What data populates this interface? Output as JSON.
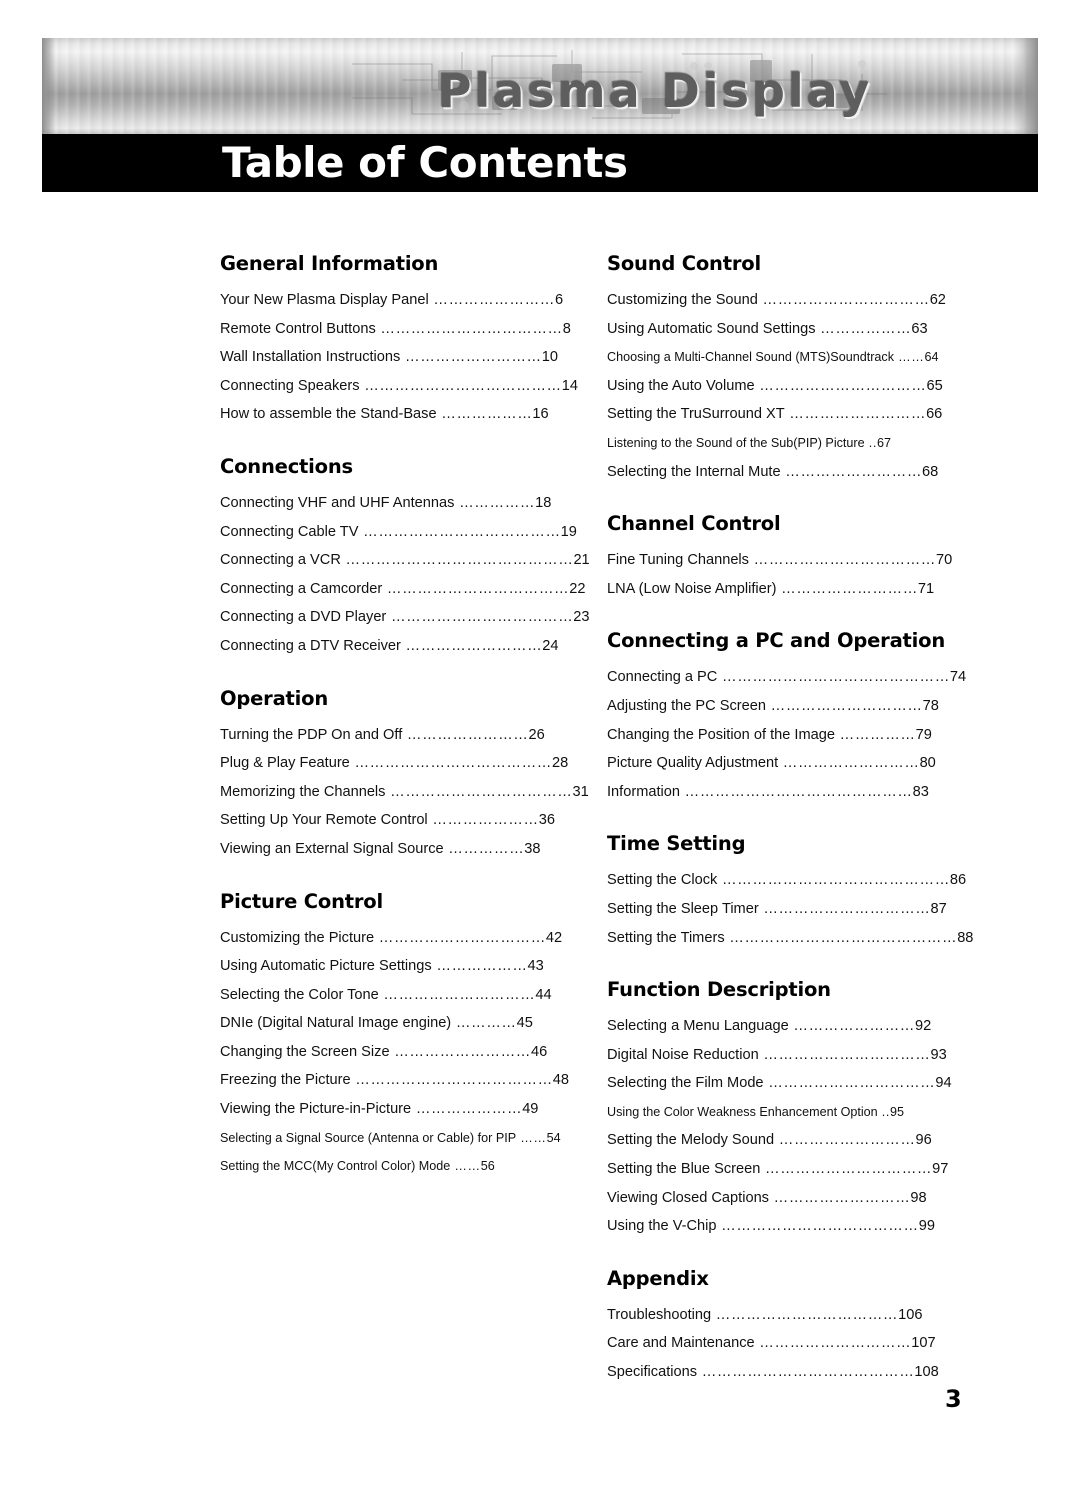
{
  "banner": {
    "brand_title": "Plasma Display",
    "page_title": "Table of Contents"
  },
  "page_number": "3",
  "left_column": [
    {
      "heading": "General Information",
      "entries": [
        {
          "label": "Your New Plasma Display Panel",
          "dots": "……………………",
          "page": "6"
        },
        {
          "label": "Remote Control Buttons",
          "dots": "………………………………",
          "page": "8"
        },
        {
          "label": "Wall Installation Instructions",
          "dots": "………………………",
          "page": "10"
        },
        {
          "label": "Connecting Speakers",
          "dots": "…………………………………",
          "page": "14"
        },
        {
          "label": "How to assemble the Stand-Base",
          "dots": "………………",
          "page": "16"
        }
      ]
    },
    {
      "heading": "Connections",
      "entries": [
        {
          "label": "Connecting VHF and UHF Antennas",
          "dots": "……………",
          "page": "18"
        },
        {
          "label": "Connecting Cable TV",
          "dots": "…………………………………",
          "page": "19"
        },
        {
          "label": "Connecting a VCR",
          "dots": "………………………………………",
          "page": "21"
        },
        {
          "label": "Connecting a Camcorder",
          "dots": "………………………………",
          "page": "22"
        },
        {
          "label": "Connecting a DVD Player",
          "dots": "………………………………",
          "page": "23"
        },
        {
          "label": "Connecting a DTV Receiver",
          "dots": "………………………",
          "page": "24"
        }
      ]
    },
    {
      "heading": "Operation",
      "entries": [
        {
          "label": "Turning the PDP On and Off",
          "dots": "……………………",
          "page": "26"
        },
        {
          "label": "Plug & Play Feature",
          "dots": "…………………………………",
          "page": "28"
        },
        {
          "label": "Memorizing the Channels",
          "dots": "………………………………",
          "page": "31"
        },
        {
          "label": "Setting Up Your Remote Control",
          "dots": "…………………",
          "page": "36"
        },
        {
          "label": "Viewing an External Signal Source",
          "dots": "……………",
          "page": "38"
        }
      ]
    },
    {
      "heading": "Picture Control",
      "entries": [
        {
          "label": "Customizing the Picture",
          "dots": "……………………………",
          "page": "42"
        },
        {
          "label": "Using Automatic Picture Settings",
          "dots": "………………",
          "page": "43"
        },
        {
          "label": "Selecting the Color Tone",
          "dots": "…………………………",
          "page": "44"
        },
        {
          "label": "DNIe (Digital Natural Image engine)",
          "dots": "…………",
          "page": "45"
        },
        {
          "label": "Changing the Screen Size",
          "dots": "………………………",
          "page": "46"
        },
        {
          "label": "Freezing the Picture",
          "dots": "…………………………………",
          "page": "48"
        },
        {
          "label": "Viewing the Picture-in-Picture",
          "dots": "…………………",
          "page": "49"
        },
        {
          "label": "Selecting a Signal Source (Antenna or Cable) for PIP",
          "dots": "……",
          "page": "54",
          "small": true
        },
        {
          "label": "Setting the MCC(My Control Color) Mode",
          "dots": "……",
          "page": "56",
          "small": true
        }
      ]
    }
  ],
  "right_column": [
    {
      "heading": "Sound Control",
      "entries": [
        {
          "label": "Customizing the Sound",
          "dots": "……………………………",
          "page": "62"
        },
        {
          "label": "Using Automatic Sound Settings",
          "dots": "………………",
          "page": "63"
        },
        {
          "label": "Choosing a Multi-Channel Sound (MTS)Soundtrack",
          "dots": "……",
          "page": "64",
          "small": true
        },
        {
          "label": "Using the Auto Volume",
          "dots": "……………………………",
          "page": "65"
        },
        {
          "label": "Setting the TruSurround XT",
          "dots": "………………………",
          "page": "66"
        },
        {
          "label": "Listening to the Sound of the Sub(PIP) Picture",
          "dots": "..",
          "page": "67",
          "small": true
        },
        {
          "label": "Selecting the Internal Mute",
          "dots": "………………………",
          "page": "68"
        }
      ]
    },
    {
      "heading": "Channel Control",
      "entries": [
        {
          "label": "Fine Tuning Channels",
          "dots": "………………………………",
          "page": "70"
        },
        {
          "label": "LNA (Low Noise Amplifier)",
          "dots": "………………………",
          "page": "71"
        }
      ]
    },
    {
      "heading": "Connecting a PC and Operation",
      "entries": [
        {
          "label": "Connecting a PC",
          "dots": "………………………………………",
          "page": "74"
        },
        {
          "label": "Adjusting the PC Screen",
          "dots": "…………………………",
          "page": "78"
        },
        {
          "label": "Changing the Position of the Image",
          "dots": "……………",
          "page": "79"
        },
        {
          "label": "Picture Quality Adjustment",
          "dots": "………………………",
          "page": "80"
        },
        {
          "label": "Information",
          "dots": "………………………………………",
          "page": "83"
        }
      ]
    },
    {
      "heading": "Time Setting",
      "entries": [
        {
          "label": "Setting the Clock",
          "dots": "………………………………………",
          "page": "86"
        },
        {
          "label": "Setting the Sleep Timer",
          "dots": "……………………………",
          "page": "87"
        },
        {
          "label": "Setting the Timers",
          "dots": "………………………………………",
          "page": "88"
        }
      ]
    },
    {
      "heading": "Function Description",
      "entries": [
        {
          "label": "Selecting a Menu Language",
          "dots": "……………………",
          "page": "92"
        },
        {
          "label": "Digital Noise Reduction",
          "dots": "……………………………",
          "page": "93"
        },
        {
          "label": "Selecting the Film Mode",
          "dots": "……………………………",
          "page": "94"
        },
        {
          "label": "Using the Color Weakness Enhancement Option",
          "dots": "..",
          "page": "95",
          "small": true
        },
        {
          "label": "Setting the Melody Sound",
          "dots": "………………………",
          "page": "96"
        },
        {
          "label": "Setting the Blue Screen",
          "dots": "……………………………",
          "page": "97"
        },
        {
          "label": "Viewing Closed Captions",
          "dots": "………………………",
          "page": "98"
        },
        {
          "label": "Using the V-Chip",
          "dots": "…………………………………",
          "page": "99"
        }
      ]
    },
    {
      "heading": "Appendix",
      "entries": [
        {
          "label": "Troubleshooting",
          "dots": "………………………………",
          "page": "106"
        },
        {
          "label": "Care and Maintenance",
          "dots": "…………………………",
          "page": "107"
        },
        {
          "label": "Specifications",
          "dots": "……………………………………",
          "page": "108"
        }
      ]
    }
  ]
}
